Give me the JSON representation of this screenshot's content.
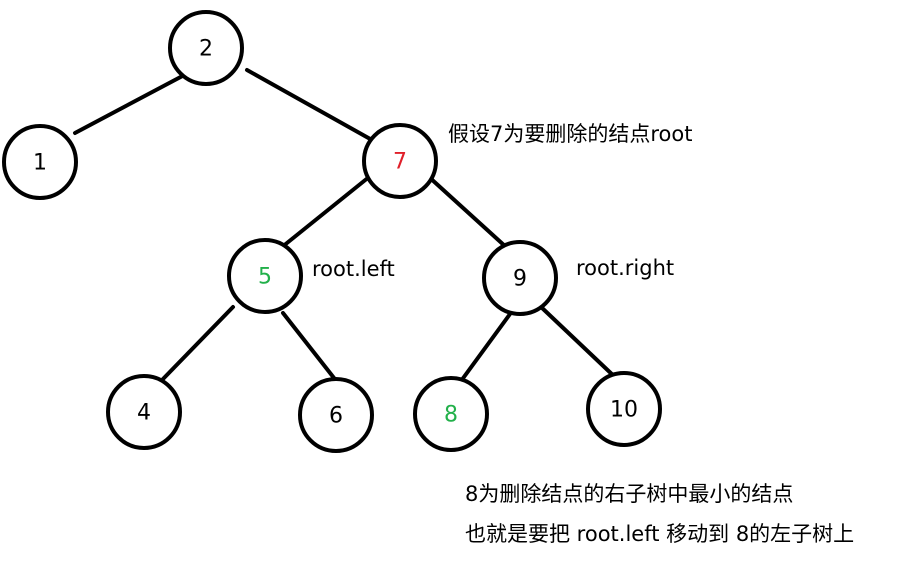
{
  "colors": {
    "default": "#000000",
    "deleted": "#e0202a",
    "highlight": "#22b04a"
  },
  "nodes": [
    {
      "id": "n2",
      "label": "2",
      "color": "default"
    },
    {
      "id": "n1",
      "label": "1",
      "color": "default"
    },
    {
      "id": "n7",
      "label": "7",
      "color": "deleted"
    },
    {
      "id": "n5",
      "label": "5",
      "color": "highlight"
    },
    {
      "id": "n9",
      "label": "9",
      "color": "default"
    },
    {
      "id": "n4",
      "label": "4",
      "color": "default"
    },
    {
      "id": "n6",
      "label": "6",
      "color": "default"
    },
    {
      "id": "n8",
      "label": "8",
      "color": "highlight"
    },
    {
      "id": "n10",
      "label": "10",
      "color": "default"
    }
  ],
  "edges": [
    {
      "from": "n2",
      "to": "n1"
    },
    {
      "from": "n2",
      "to": "n7"
    },
    {
      "from": "n7",
      "to": "n5"
    },
    {
      "from": "n7",
      "to": "n9"
    },
    {
      "from": "n5",
      "to": "n4"
    },
    {
      "from": "n5",
      "to": "n6"
    },
    {
      "from": "n9",
      "to": "n8"
    },
    {
      "from": "n9",
      "to": "n10"
    }
  ],
  "annotations": {
    "delete_root": "假设7为要删除的结点root",
    "root_left": "root.left",
    "root_right": "root.right",
    "note_line1": "8为删除结点的右子树中最小的结点",
    "note_line2": "也就是要把 root.left 移动到 8的左子树上"
  }
}
